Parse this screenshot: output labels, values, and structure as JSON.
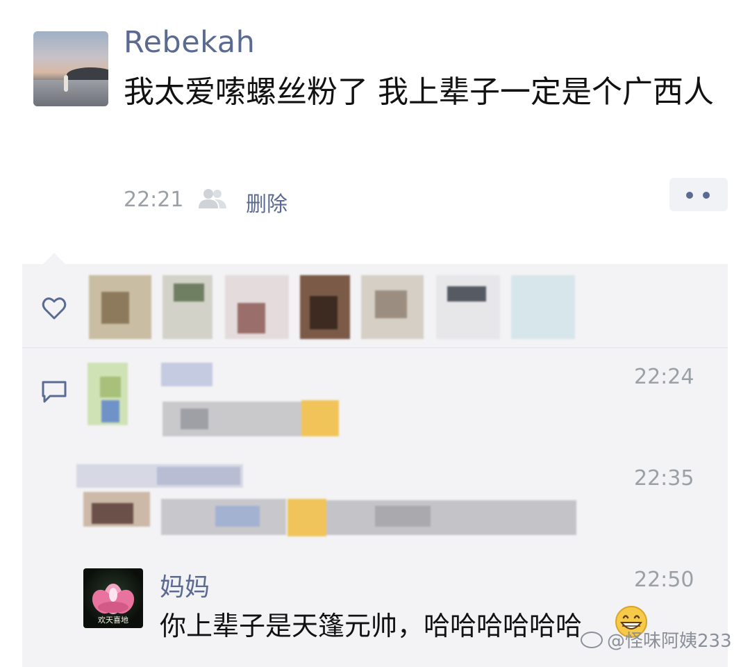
{
  "post": {
    "author": "Rebekah",
    "text": "我太爱嗦螺丝粉了 我上辈子一定是个广西人",
    "time": "22:21",
    "delete_label": "删除"
  },
  "comments": [
    {
      "time": "22:24"
    },
    {
      "time": "22:35"
    },
    {
      "name": "妈妈",
      "time": "22:50",
      "text": "你上辈子是天篷元帅，哈哈哈哈哈哈"
    }
  ],
  "mom_avatar_caption": "欢天喜地",
  "watermark": "@怪味阿姨233",
  "icons": [
    "heart-icon",
    "comment-icon",
    "friends-visibility-icon",
    "more-dots-icon",
    "grin-emoji-icon"
  ],
  "colors": {
    "accent": "#5b6a91",
    "panel": "#f3f3f5",
    "muted": "#9aa0a6"
  }
}
